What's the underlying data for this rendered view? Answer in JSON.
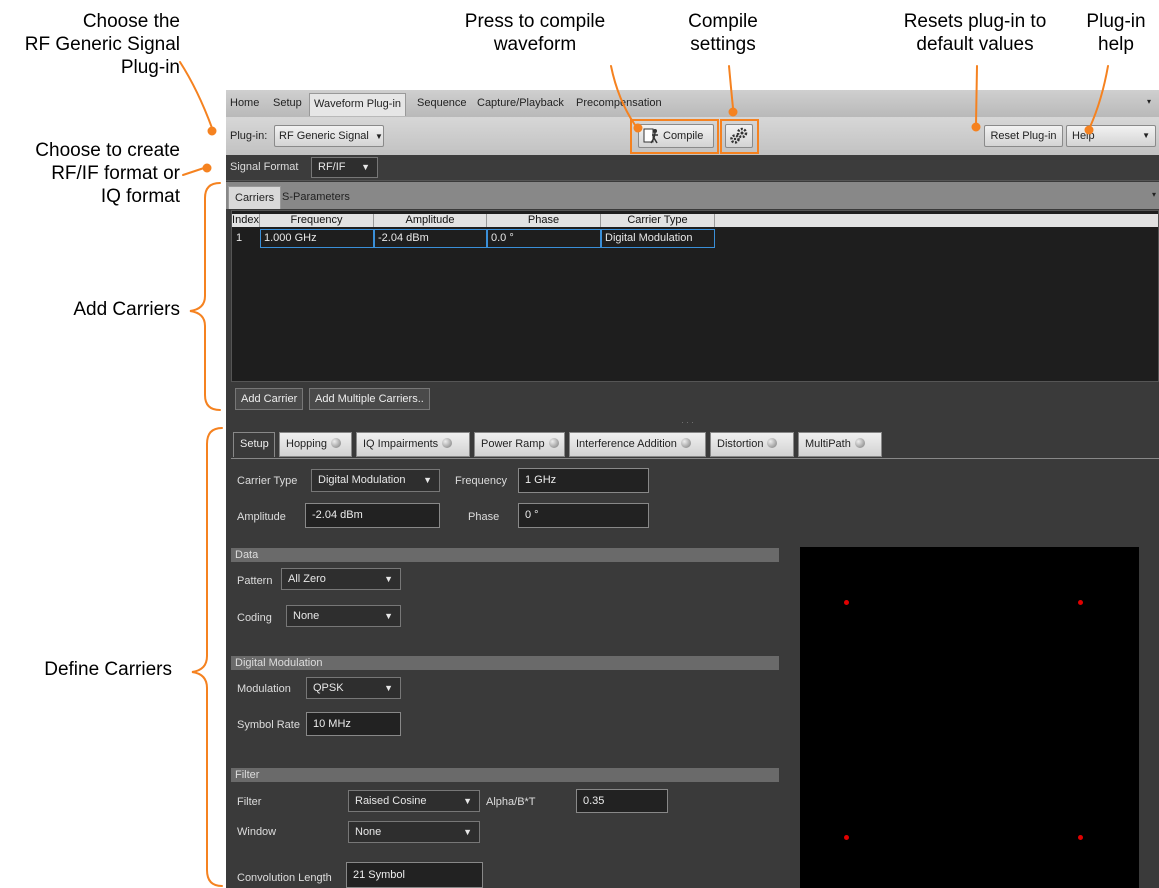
{
  "annotations": {
    "choose_plugin": [
      "Choose the",
      "RF Generic Signal",
      "Plug-in"
    ],
    "compile_press": [
      "Press to compile",
      "waveform"
    ],
    "compile_settings": [
      "Compile",
      "settings"
    ],
    "reset_plugin": [
      "Resets plug-in to",
      "default values"
    ],
    "plugin_help": [
      "Plug-in",
      "help"
    ],
    "signal_format": [
      "Choose to create",
      "RF/IF format or",
      "IQ format"
    ],
    "add_carriers": "Add Carriers",
    "define_carriers": "Define Carriers"
  },
  "menu": {
    "items": [
      "Home",
      "Setup",
      "Waveform Plug-in",
      "Sequence",
      "Capture/Playback",
      "Precompensation"
    ],
    "active": "Waveform Plug-in"
  },
  "toolbar": {
    "plugin_label": "Plug-in:",
    "plugin_value": "RF Generic Signal",
    "compile_label": "Compile",
    "reset_label": "Reset Plug-in",
    "help_label": "Help"
  },
  "signal_format": {
    "label": "Signal Format",
    "value": "RF/IF"
  },
  "carrier_tabs": [
    "Carriers",
    "S-Parameters"
  ],
  "carrier_table": {
    "columns": [
      "Index",
      "Frequency",
      "Amplitude",
      "Phase",
      "Carrier Type"
    ],
    "rows": [
      {
        "index": "1",
        "frequency": "1.000 GHz",
        "amplitude": "-2.04 dBm",
        "phase": "0.0 °",
        "carrier_type": "Digital Modulation"
      }
    ]
  },
  "carrier_buttons": {
    "add": "Add Carrier",
    "add_multiple": "Add Multiple Carriers.."
  },
  "define_tabs": [
    "Setup",
    "Hopping",
    "IQ Impairments",
    "Power Ramp",
    "Interference Addition",
    "Distortion",
    "MultiPath"
  ],
  "setup": {
    "carrier_type_label": "Carrier Type",
    "carrier_type_value": "Digital Modulation",
    "frequency_label": "Frequency",
    "frequency_value": "1 GHz",
    "amplitude_label": "Amplitude",
    "amplitude_value": "-2.04 dBm",
    "phase_label": "Phase",
    "phase_value": "0 °"
  },
  "data_section": {
    "title": "Data",
    "pattern_label": "Pattern",
    "pattern_value": "All Zero",
    "coding_label": "Coding",
    "coding_value": "None"
  },
  "modulation_section": {
    "title": "Digital Modulation",
    "modulation_label": "Modulation",
    "modulation_value": "QPSK",
    "symbol_rate_label": "Symbol Rate",
    "symbol_rate_value": "10 MHz"
  },
  "filter_section": {
    "title": "Filter",
    "filter_label": "Filter",
    "filter_value": "Raised Cosine",
    "alpha_label": "Alpha/B*T",
    "alpha_value": "0.35",
    "window_label": "Window",
    "window_value": "None",
    "conv_label": "Convolution Length",
    "conv_value": "21 Symbol"
  },
  "colors": {
    "highlight": "#f58220",
    "constellation_point": "#e00000"
  },
  "icons": [
    "compile-icon",
    "compile-settings-gear-icon",
    "dropdown-arrow-icon",
    "tab-status-dot-icon"
  ]
}
